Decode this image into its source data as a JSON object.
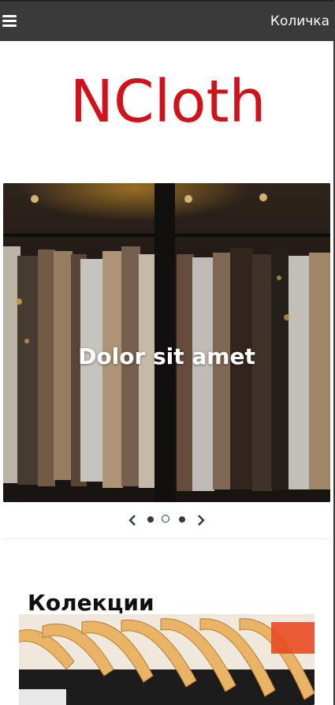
{
  "nav": {
    "menu_icon": "hamburger-menu-icon",
    "cart_label": "Количка",
    "bg_color": "#3a3a3a"
  },
  "brand": {
    "logo_text": "NCloth",
    "logo_color": "#d0121b"
  },
  "carousel": {
    "slide_caption": "Dolor sit amet",
    "slide_count": 3,
    "active_index": 1,
    "prev_icon": "chevron-left-icon",
    "next_icon": "chevron-right-icon"
  },
  "collections": {
    "heading": "Колекции"
  }
}
